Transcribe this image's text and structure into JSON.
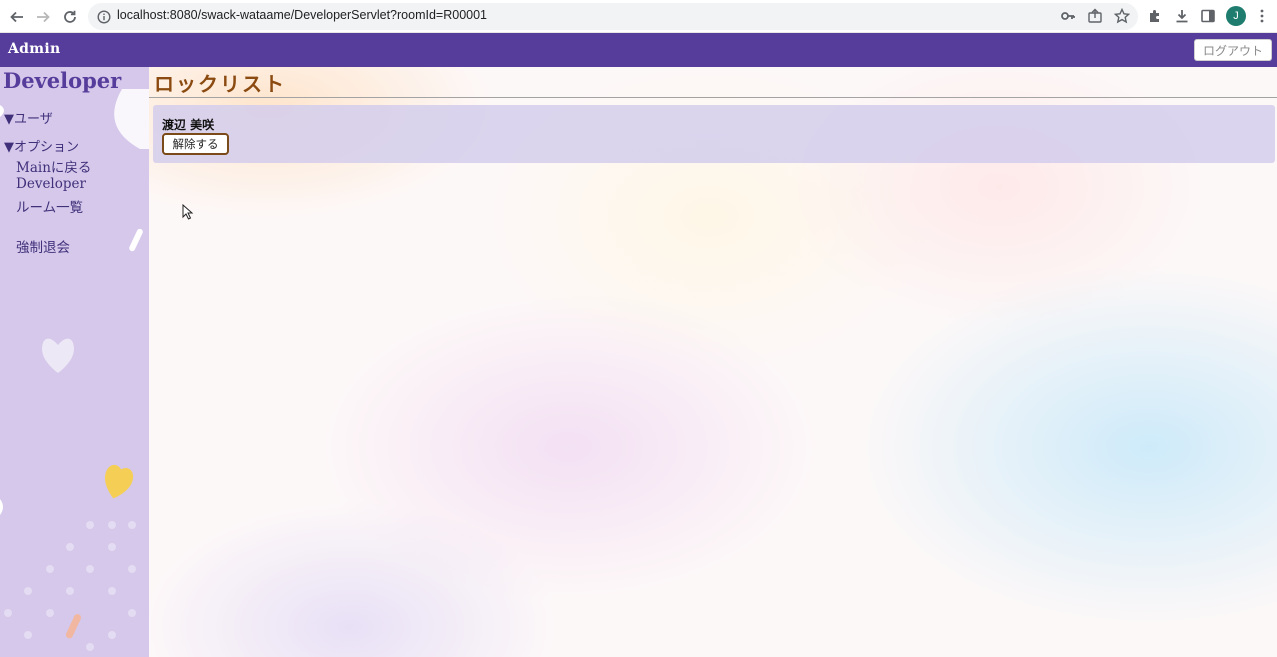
{
  "browser": {
    "url": "localhost:8080/swack-wataame/DeveloperServlet?roomId=R00001",
    "profile_initial": "J",
    "icons": [
      "back-icon",
      "forward-icon",
      "reload-icon",
      "info-icon",
      "key-icon",
      "share-icon",
      "star-icon",
      "extensions-icon",
      "download-icon",
      "sidepanel-icon",
      "menu-icon"
    ]
  },
  "header": {
    "title": "Admin",
    "logout_label": "ログアウト"
  },
  "sidebar": {
    "title": "Developer",
    "user_section": "▼ユーザ",
    "option_section": "▼オプション",
    "links": {
      "back_to_main": "Mainに戻る",
      "developer": "Developer",
      "room_list": "ルーム一覧",
      "force_leave": "強制退会"
    }
  },
  "main": {
    "title": "ロックリスト",
    "locked_users": [
      {
        "name": "渡辺 美咲",
        "action": "解除する"
      }
    ]
  },
  "colors": {
    "header_bg": "#573d9b",
    "sidebar_bg": "#d5c8ea",
    "title_color": "#8a4a10",
    "button_border": "#7a4a18"
  }
}
